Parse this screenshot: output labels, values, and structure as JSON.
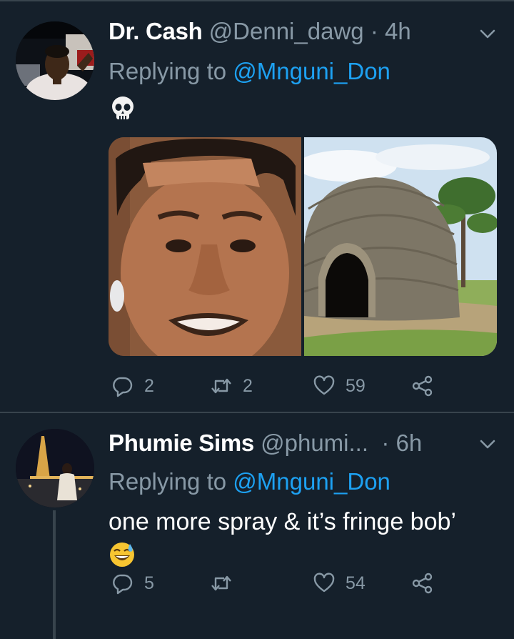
{
  "colors": {
    "background": "#15202b",
    "secondary_text": "#8899a6",
    "link": "#1da1f2",
    "divider": "#38444d"
  },
  "tweets": [
    {
      "name": "Dr. Cash",
      "handle": "@Denni_dawg",
      "separator": "·",
      "time": "4h",
      "reply_prefix": "Replying to",
      "reply_to": "@Mnguni_Don",
      "text_emoji": "skull-emoji",
      "media": [
        {
          "icon": "face-closeup-photo"
        },
        {
          "icon": "grass-hut-photo"
        }
      ],
      "actions": {
        "replies": "2",
        "retweets": "2",
        "likes": "59"
      }
    },
    {
      "name": "Phumie Sims",
      "handle": "@phumi...",
      "separator": "·",
      "time": "6h",
      "reply_prefix": "Replying to",
      "reply_to": "@Mnguni_Don",
      "text": "one more spray & it’s fringe bob’",
      "text_emoji": "grinning-sweat-emoji",
      "actions": {
        "replies": "5",
        "retweets": "",
        "likes": "54"
      }
    }
  ]
}
